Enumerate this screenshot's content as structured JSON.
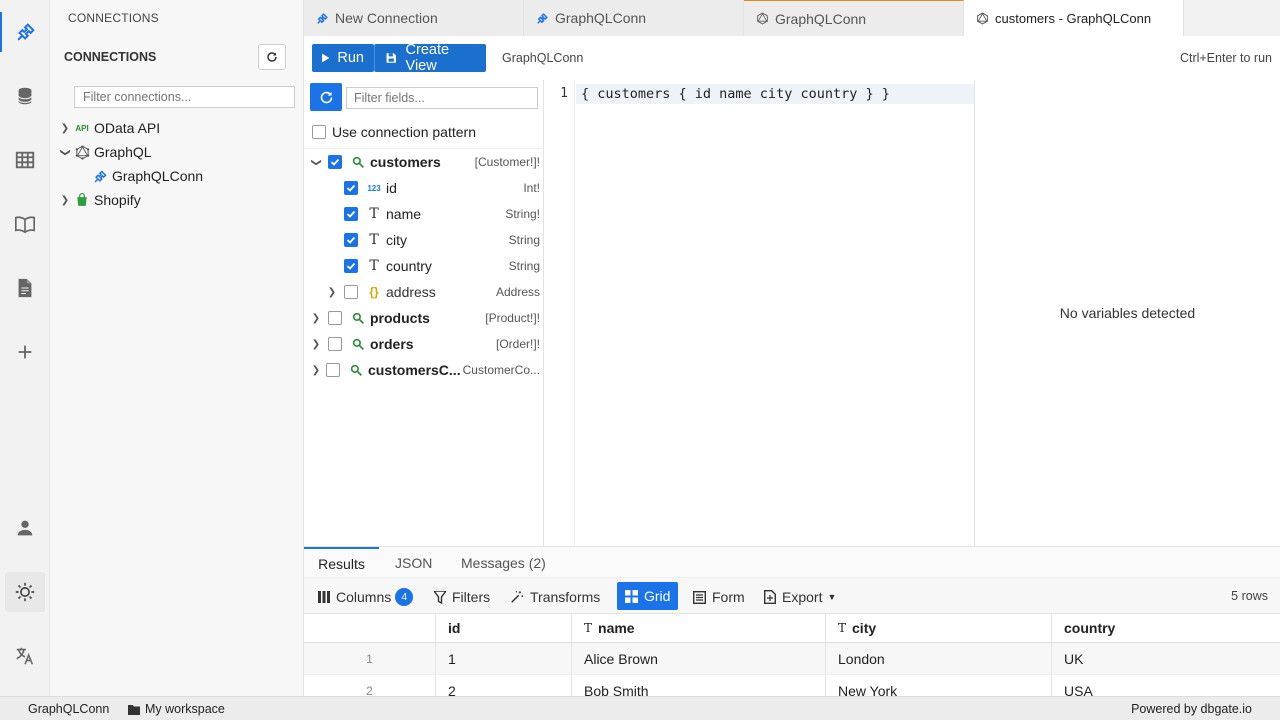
{
  "sidebar": {
    "caption": "CONNECTIONS",
    "header": "CONNECTIONS",
    "filter_placeholder": "Filter connections...",
    "tree": [
      {
        "label": "OData API",
        "icon": "api-icon"
      },
      {
        "label": "GraphQL",
        "icon": "graphql-icon"
      },
      {
        "label": "GraphQLConn",
        "icon": "plug-icon"
      },
      {
        "label": "Shopify",
        "icon": "shopify-icon"
      }
    ]
  },
  "tabs": [
    {
      "label": "New Connection"
    },
    {
      "label": "GraphQLConn"
    },
    {
      "label": "GraphQLConn"
    },
    {
      "label": "customers - GraphQLConn"
    }
  ],
  "toolbar": {
    "run_label": "Run",
    "create_view_label": "Create View",
    "connection": "GraphQLConn",
    "hint": "Ctrl+Enter to run"
  },
  "fields": {
    "filter_placeholder": "Filter fields...",
    "use_pattern_label": "Use connection pattern",
    "items": [
      {
        "name": "customers",
        "type": "[Customer!]!"
      },
      {
        "name": "id",
        "type": "Int!"
      },
      {
        "name": "name",
        "type": "String!"
      },
      {
        "name": "city",
        "type": "String"
      },
      {
        "name": "country",
        "type": "String"
      },
      {
        "name": "address",
        "type": "Address"
      },
      {
        "name": "products",
        "type": "[Product!]!"
      },
      {
        "name": "orders",
        "type": "[Order!]!"
      },
      {
        "name": "customersC...",
        "type": "CustomerCo..."
      }
    ]
  },
  "editor": {
    "line_number": "1",
    "code": "{ customers { id name city country } }"
  },
  "variables": {
    "empty_text": "No variables detected"
  },
  "results": {
    "tabs": [
      "Results",
      "JSON",
      "Messages (2)"
    ],
    "tools": {
      "columns": "Columns",
      "columns_count": "4",
      "filters": "Filters",
      "transforms": "Transforms",
      "grid": "Grid",
      "form": "Form",
      "export": "Export"
    },
    "row_count": "5 rows",
    "columns": [
      "id",
      "name",
      "city",
      "country"
    ],
    "rows": [
      {
        "num": "1",
        "id": "1",
        "name": "Alice Brown",
        "city": "London",
        "country": "UK"
      },
      {
        "num": "2",
        "id": "2",
        "name": "Bob Smith",
        "city": "New York",
        "country": "USA"
      }
    ]
  },
  "status": {
    "connection": "GraphQLConn",
    "workspace": "My workspace",
    "powered": "Powered by dbgate.io"
  },
  "colors": {
    "accent": "#1a73e8",
    "run_button": "#1a6fcf",
    "tab_active_border": "#e0882a"
  }
}
